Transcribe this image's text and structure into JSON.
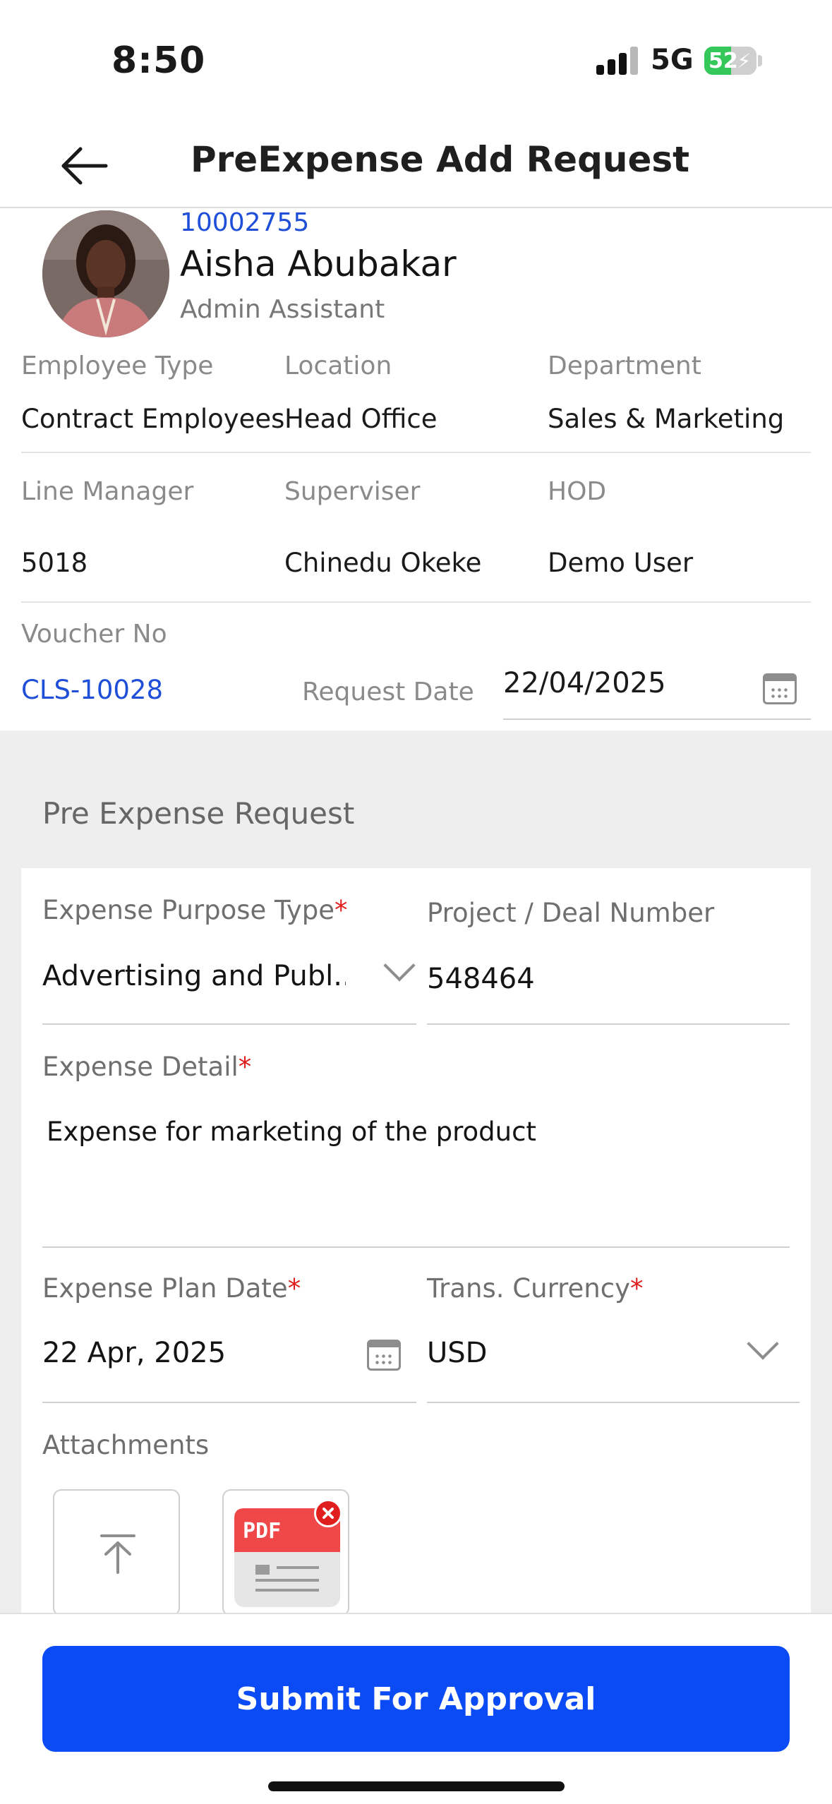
{
  "status_bar": {
    "time": "8:50",
    "network": "5G",
    "battery": "52",
    "battery_level": 52
  },
  "header": {
    "title": "PreExpense Add Request"
  },
  "employee": {
    "id": "10002755",
    "name": "Aisha Abubakar",
    "role": "Admin Assistant",
    "employee_type_label": "Employee Type",
    "employee_type": "Contract Employees",
    "location_label": "Location",
    "location": "Head Office",
    "department_label": "Department",
    "department": "Sales & Marketing",
    "line_manager_label": "Line Manager",
    "line_manager": "5018",
    "supervisor_label": "Superviser",
    "supervisor": "Chinedu Okeke",
    "hod_label": "HOD",
    "hod": "Demo User",
    "voucher_label": "Voucher No",
    "voucher": "CLS-10028",
    "request_date_label": "Request Date",
    "request_date": "22/04/2025"
  },
  "form": {
    "section_title": "Pre Expense Request",
    "purpose_type_label": "Expense Purpose Type",
    "purpose_type_value": "Advertising and Publ...",
    "project_label": "Project / Deal Number",
    "project_value": "548464",
    "detail_label": "Expense Detail",
    "detail_value": "Expense for marketing of the product",
    "plan_date_label": "Expense Plan Date",
    "plan_date_value": "22 Apr, 2025",
    "currency_label": "Trans. Currency",
    "currency_value": "USD",
    "attachments_label": "Attachments",
    "required_mark": "*",
    "pdf_label": "PDF"
  },
  "actions": {
    "submit_label": "Submit For Approval"
  },
  "colors": {
    "primary": "#0a4bf5",
    "link": "#1f4fd8",
    "required": "#e01e1e"
  }
}
